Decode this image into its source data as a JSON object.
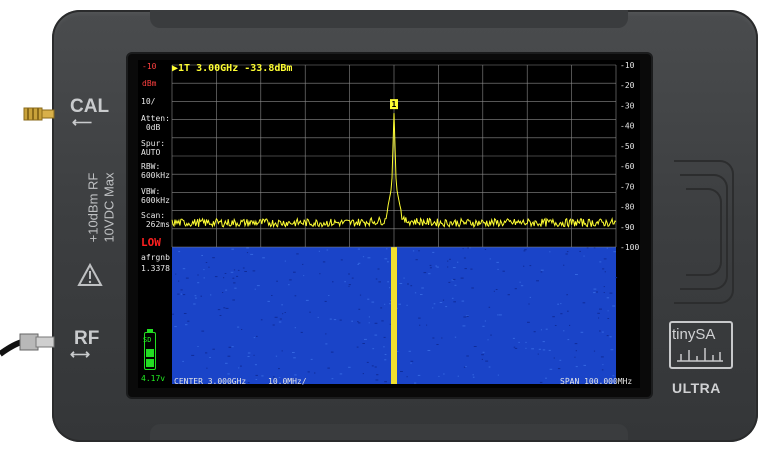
{
  "device": {
    "cal_label": "CAL",
    "rf_label": "RF",
    "max_input_line1": "+10dBm RF",
    "max_input_line2": "10VDC Max",
    "logo": "tinySA",
    "model": "ULTRA",
    "warning_icon": "warning-triangle-icon"
  },
  "screen": {
    "ref_level": "-10",
    "ref_unit": "dBm",
    "marker_readout": "▶1T   3.00GHz -33.8dBm",
    "marker_label": "1",
    "scale_per_div": "10/",
    "attenuation": "Atten:\n 0dB",
    "spur": "Spur:\nAUTO",
    "rbw": "RBW:\n600kHz",
    "vbw": "VBW:\n600kHz",
    "scan": "Scan:\n 262ms",
    "lna_mode": "LOW",
    "waterfall_param": "afrgnb",
    "waterfall_value": "1.3378",
    "battery_voltage": "4.17v",
    "center": "CENTER 3.000GHz",
    "div": "10.0MHz/",
    "span": "SPAN 100.000MHz",
    "sd_icon": "sd-card-icon",
    "battery_icon": "battery-icon",
    "trace_color": "#ffff33",
    "waterfall_color": "#1a44c8"
  },
  "chart_data": {
    "type": "line",
    "title": "",
    "xlabel": "",
    "ylabel": "",
    "y_ticks": [
      "-10",
      "-20",
      "-30",
      "-40",
      "-50",
      "-60",
      "-70",
      "-80",
      "-90",
      "-100"
    ],
    "ylim": [
      -100,
      -10
    ],
    "xlim_mhz": [
      2950,
      3050
    ],
    "grid": true,
    "noise_floor_dbm": -88,
    "series": [
      {
        "points": [
          [
            2950,
            -88
          ],
          [
            2990,
            -88
          ],
          [
            2998,
            -87
          ],
          [
            2999.5,
            -70
          ],
          [
            3000,
            -33.8
          ],
          [
            3000.5,
            -70
          ],
          [
            3002,
            -87
          ],
          [
            3010,
            -88
          ],
          [
            3050,
            -88
          ]
        ]
      }
    ]
  }
}
